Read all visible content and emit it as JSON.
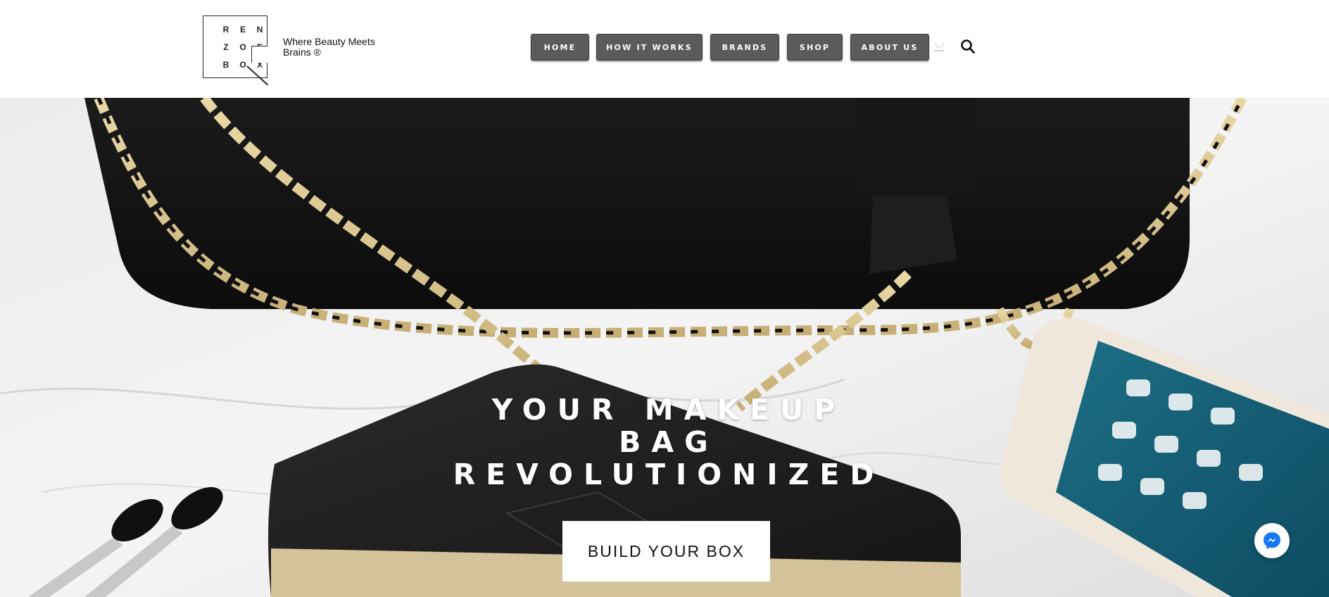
{
  "brand": {
    "logo_letters": [
      "R",
      "E",
      "N",
      "Z",
      "O",
      "E",
      "B",
      "O",
      "X"
    ],
    "tagline_line1": "Where Beauty Meets",
    "tagline_line2": "Brains ®"
  },
  "nav": {
    "items": [
      {
        "label": "HOME"
      },
      {
        "label": "HOW IT WORKS"
      },
      {
        "label": "BRANDS"
      },
      {
        "label": "SHOP"
      },
      {
        "label": "ABOUT US"
      }
    ]
  },
  "icons": {
    "cart": "cart-icon",
    "search": "search-icon",
    "messenger": "messenger-icon"
  },
  "hero": {
    "title_line1": "YOUR MAKEUP",
    "title_line2": "BAG",
    "title_line3": "REVOLUTIONIZED",
    "cta_label": "BUILD YOUR BOX"
  },
  "colors": {
    "nav_button_bg": "#5b5b5b",
    "nav_button_text": "#ffffff",
    "hero_title": "#ffffff",
    "cta_bg": "#ffffff",
    "messenger_blue": "#1877f2"
  }
}
